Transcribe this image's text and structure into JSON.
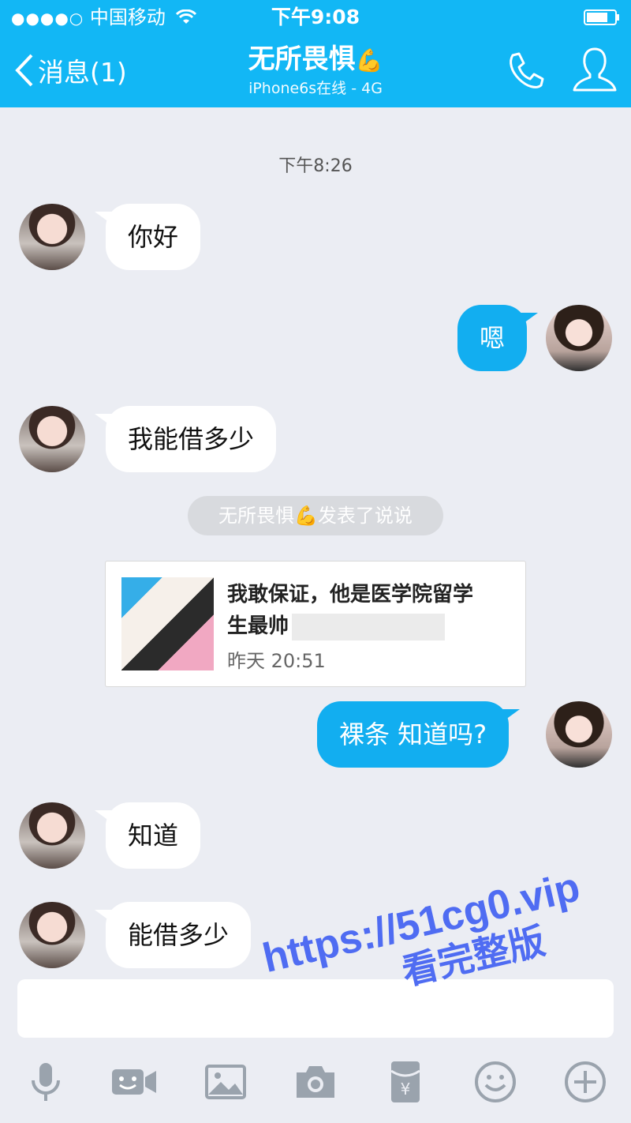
{
  "status": {
    "signal": "●●●●○",
    "carrier": "中国移动",
    "time": "下午9:08"
  },
  "nav": {
    "back_label": "消息(1)",
    "contact_name": "无所畏惧",
    "name_emoji": "💪",
    "contact_status": "iPhone6s在线 - 4G"
  },
  "chat": {
    "timestamp": "下午8:26",
    "messages": [
      {
        "side": "in",
        "text": "你好"
      },
      {
        "side": "out",
        "text": "嗯"
      },
      {
        "side": "in",
        "text": "我能借多少"
      },
      {
        "side": "out",
        "text": "裸条 知道吗?"
      },
      {
        "side": "in",
        "text": "知道"
      },
      {
        "side": "in",
        "text": "能借多少"
      }
    ],
    "system_notice": "无所畏惧💪发表了说说",
    "post_card": {
      "title_line1": "我敢保证，他是医学院留学",
      "title_line2": "生最帅",
      "date": "昨天 20:51"
    }
  },
  "watermark": {
    "line1": "https://51cg0.vip",
    "line2": "看完整版"
  },
  "toolbar": {
    "icons": [
      "microphone-icon",
      "video-call-icon",
      "image-icon",
      "camera-icon",
      "red-packet-icon",
      "emoji-icon",
      "plus-icon"
    ]
  },
  "colors": {
    "header": "#12b7f5",
    "out_bubble": "#12aef0",
    "background": "#ebedf3",
    "watermark": "#4f6cf2"
  }
}
